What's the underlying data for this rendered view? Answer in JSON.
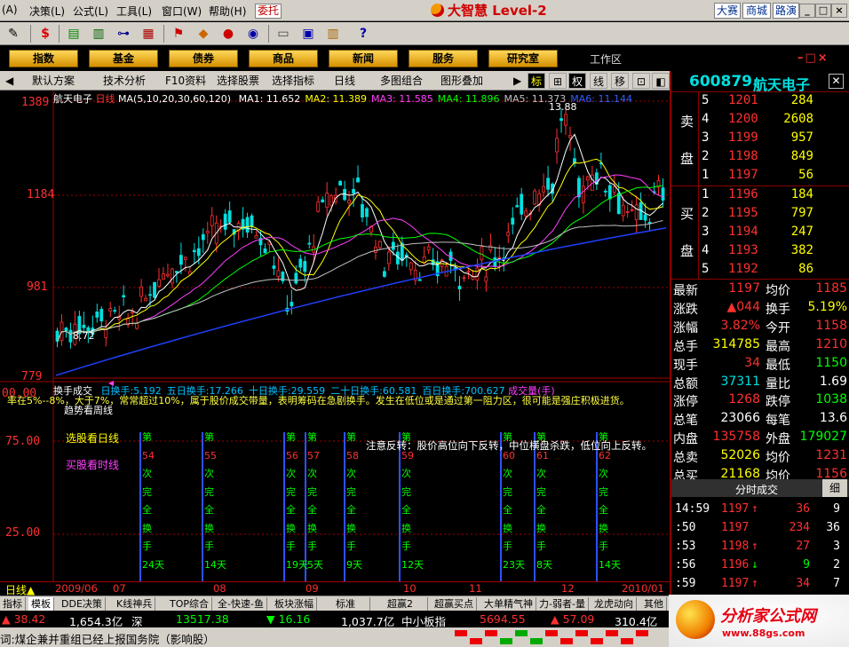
{
  "menu": [
    "(A)",
    "决策(L)",
    "公式(L)",
    "工具(L)",
    "窗口(W)",
    "帮助(H)"
  ],
  "entrust": "委托",
  "brand": "大智慧 Level-2",
  "quick": [
    "大赛",
    "商城",
    "路演"
  ],
  "win": [
    "_",
    "□",
    "×"
  ],
  "nav": [
    "指数",
    "基金",
    "债券",
    "商品",
    "新闻",
    "服务",
    "研究室"
  ],
  "workarea": "工作区",
  "sub": [
    "默认方案",
    "技术分析",
    "F10资料",
    "选择股票",
    "选择指标",
    "日线",
    "多图组合",
    "图形叠加"
  ],
  "sub_btns": [
    "标",
    "权",
    "线",
    "移"
  ],
  "stock": {
    "code": "600879",
    "name": "航天电子"
  },
  "chart": {
    "title": "航天电子",
    "period": "日线",
    "ma_label": "MA(5,10,20,30,60,120)",
    "ma": [
      {
        "label": "MA1:",
        "value": "11.652",
        "color": "#ffffff"
      },
      {
        "label": "MA2:",
        "value": "11.389",
        "color": "#ffff00"
      },
      {
        "label": "MA3:",
        "value": "11.585",
        "color": "#ff40ff"
      },
      {
        "label": "MA4:",
        "value": "11.896",
        "color": "#00ff00"
      },
      {
        "label": "MA5:",
        "value": "11.373",
        "color": "#c0c0c0"
      },
      {
        "label": "MA6:",
        "value": "11.144",
        "color": "#3060ff"
      }
    ],
    "high_mark": "13.88",
    "low_mark": "8.72",
    "yticks": [
      "1389",
      "1184",
      "981",
      "779"
    ]
  },
  "chart_data": {
    "type": "candlestick",
    "title": "航天电子 日线",
    "x": [
      "2009/06",
      "07",
      "08",
      "09",
      "10",
      "11",
      "12",
      "2010/01"
    ],
    "ylim": [
      7.79,
      13.89
    ],
    "yticks": [
      7.79,
      9.81,
      11.84,
      13.89
    ],
    "annotations": [
      {
        "label": "13.88"
      },
      {
        "label": "8.72"
      }
    ],
    "series": [
      {
        "name": "MA1",
        "value": 11.652
      },
      {
        "name": "MA2",
        "value": 11.389
      },
      {
        "name": "MA3",
        "value": 11.585
      },
      {
        "name": "MA4",
        "value": 11.896
      },
      {
        "name": "MA5",
        "value": 11.373
      },
      {
        "name": "MA6",
        "value": 11.144
      }
    ]
  },
  "indicator": {
    "name": "换手成交",
    "values": [
      {
        "label": "日换手:",
        "value": "5.192",
        "color": "#00c0ff"
      },
      {
        "label": "五日换手:",
        "value": "17.266",
        "color": "#00c0ff"
      },
      {
        "label": "十日换手:",
        "value": "29.559",
        "color": "#00c0ff"
      },
      {
        "label": "二十日换手:",
        "value": "60.581",
        "color": "#00c0ff"
      },
      {
        "label": "百日换手:",
        "value": "700.627",
        "color": "#00c0ff"
      }
    ],
    "volume_label": "成交量(手)",
    "desc": "率在5%--8%，大于7%，常常超过10%，属于股价成交带量，表明筹码在急剧换手。发生在低位或是通过第一阻力区，很可能是强庄积极进货。",
    "sub": "趋势看周线",
    "buy1": "选股看日线",
    "buy2": "买股看时线",
    "note": "注意反转：股价高位向下反转，中位横盘杀跌，低位向上反转。",
    "yticks": [
      "00.00",
      "75.00",
      "25.00"
    ]
  },
  "signals": [
    {
      "n": "54",
      "d": "24天"
    },
    {
      "n": "55",
      "d": "14天"
    },
    {
      "n": "56",
      "d": "19天"
    },
    {
      "n": "57",
      "d": "5天"
    },
    {
      "n": "58",
      "d": "9天"
    },
    {
      "n": "59",
      "d": "12天"
    },
    {
      "n": "60",
      "d": "23天"
    },
    {
      "n": "61",
      "d": "8天"
    },
    {
      "n": "62",
      "d": "14天"
    }
  ],
  "signal_words": [
    "第",
    "次",
    "完",
    "全",
    "换",
    "手"
  ],
  "dates": {
    "day_btn": "日线",
    "labels": [
      "2009/06",
      "07",
      "08",
      "09",
      "10",
      "11",
      "12",
      "2010/01"
    ]
  },
  "tabs": [
    "指标",
    "模板",
    "DDE决策",
    "K线神兵",
    "TOP综合",
    "全-快速-鱼",
    "板块涨幅",
    "标准",
    "超赢2",
    "超赢买点",
    "大单精气神",
    "力-弱者-量",
    "龙虎动向",
    "其他"
  ],
  "status": {
    "i1": "▲ 38.42",
    "v1": "1,654.3亿",
    "n1": "深",
    "p2": "13517.38",
    "c2": "▼ 16.16",
    "v2": "1,037.7亿",
    "n2": "中小板指",
    "p3": "5694.55",
    "c3": "▲ 57.09",
    "v3": "310.4亿"
  },
  "news": "词:煤企兼并重组已经上报国务院（影响股）",
  "orderbook": {
    "sell_label": [
      "卖",
      "盘"
    ],
    "buy_label": [
      "买",
      "盘"
    ],
    "sell": [
      {
        "i": "5",
        "p": "1201",
        "v": "284"
      },
      {
        "i": "4",
        "p": "1200",
        "v": "2608"
      },
      {
        "i": "3",
        "p": "1199",
        "v": "957"
      },
      {
        "i": "2",
        "p": "1198",
        "v": "849"
      },
      {
        "i": "1",
        "p": "1197",
        "v": "56"
      }
    ],
    "buy": [
      {
        "i": "1",
        "p": "1196",
        "v": "184"
      },
      {
        "i": "2",
        "p": "1195",
        "v": "797"
      },
      {
        "i": "3",
        "p": "1194",
        "v": "247"
      },
      {
        "i": "4",
        "p": "1193",
        "v": "382"
      },
      {
        "i": "5",
        "p": "1192",
        "v": "86"
      }
    ]
  },
  "quote": [
    {
      "l1": "最新",
      "v1": "1197",
      "l2": "均价",
      "v2": "1185"
    },
    {
      "l1": "涨跌",
      "v1": "▲044",
      "l2": "换手",
      "v2": "5.19%"
    },
    {
      "l1": "涨幅",
      "v1": "3.82%",
      "l2": "今开",
      "v2": "1158"
    },
    {
      "l1": "总手",
      "v1": "314785",
      "l2": "最高",
      "v2": "1210"
    },
    {
      "l1": "现手",
      "v1": "34",
      "l2": "最低",
      "v2": "1150"
    },
    {
      "l1": "总额",
      "v1": "37311",
      "l2": "量比",
      "v2": "1.69"
    },
    {
      "l1": "涨停",
      "v1": "1268",
      "l2": "跌停",
      "v2": "1038"
    },
    {
      "l1": "总笔",
      "v1": "23066",
      "l2": "每笔",
      "v2": "13.6"
    },
    {
      "l1": "内盘",
      "v1": "135758",
      "l2": "外盘",
      "v2": "179027"
    },
    {
      "l1": "总卖",
      "v1": "52026",
      "l2": "均价",
      "v2": "1231"
    },
    {
      "l1": "总买",
      "v1": "21168",
      "l2": "均价",
      "v2": "1156"
    }
  ],
  "trades_head": "分时成交",
  "trades_tab": "细",
  "trades": [
    {
      "t": "14:59",
      "p": "1197",
      "a": "↑",
      "v": "36",
      "n": "9"
    },
    {
      "t": ":50",
      "p": "1197",
      "a": "",
      "v": "234",
      "n": "36"
    },
    {
      "t": ":53",
      "p": "1198",
      "a": "↑",
      "v": "27",
      "n": "3"
    },
    {
      "t": ":56",
      "p": "1196",
      "a": "↓",
      "v": "9",
      "n": "2"
    },
    {
      "t": ":59",
      "p": "1197",
      "a": "↑",
      "v": "34",
      "n": "7"
    }
  ],
  "watermark": {
    "t1": "分析家公式网",
    "t2": "www.88gs.com"
  }
}
